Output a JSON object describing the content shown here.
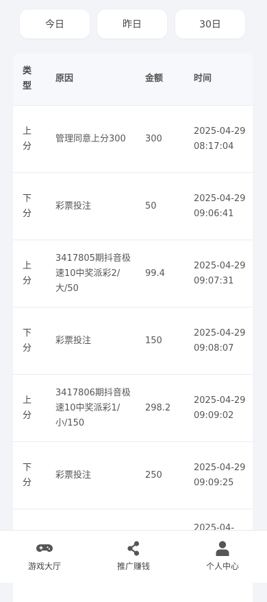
{
  "filters": {
    "today": "今日",
    "yesterday": "昨日",
    "thirty_days": "30日"
  },
  "table": {
    "headers": {
      "type": "类型",
      "reason": "原因",
      "amount": "金额",
      "time": "时间"
    },
    "rows": [
      {
        "type": "上分",
        "reason": "管理同意上分300",
        "amount": "300",
        "date": "2025-04-29",
        "clock": "08:17:04"
      },
      {
        "type": "下分",
        "reason": "彩票投注",
        "amount": "50",
        "date": "2025-04-29",
        "clock": "09:06:41"
      },
      {
        "type": "上分",
        "reason": "3417805期抖音极速10中奖派彩2/大/50",
        "amount": "99.4",
        "date": "2025-04-29",
        "clock": "09:07:31"
      },
      {
        "type": "下分",
        "reason": "彩票投注",
        "amount": "150",
        "date": "2025-04-29",
        "clock": "09:08:07"
      },
      {
        "type": "上分",
        "reason": "3417806期抖音极速10中奖派彩1/小/150",
        "amount": "298.2",
        "date": "2025-04-29",
        "clock": "09:09:02"
      },
      {
        "type": "下分",
        "reason": "彩票投注",
        "amount": "250",
        "date": "2025-04-29",
        "clock": "09:09:25"
      },
      {
        "type": "",
        "reason": "",
        "amount": "",
        "date": "2025-04-",
        "clock": ""
      }
    ]
  },
  "nav": {
    "lobby": {
      "label": "游戏大厅",
      "icon": "gamepad-icon"
    },
    "promote": {
      "label": "推广赚钱",
      "icon": "share-icon"
    },
    "profile": {
      "label": "个人中心",
      "icon": "user-icon"
    }
  },
  "colors": {
    "background": "#f3f4f8",
    "card": "#ffffff",
    "header": "#f7f8fb",
    "text": "#555555"
  }
}
